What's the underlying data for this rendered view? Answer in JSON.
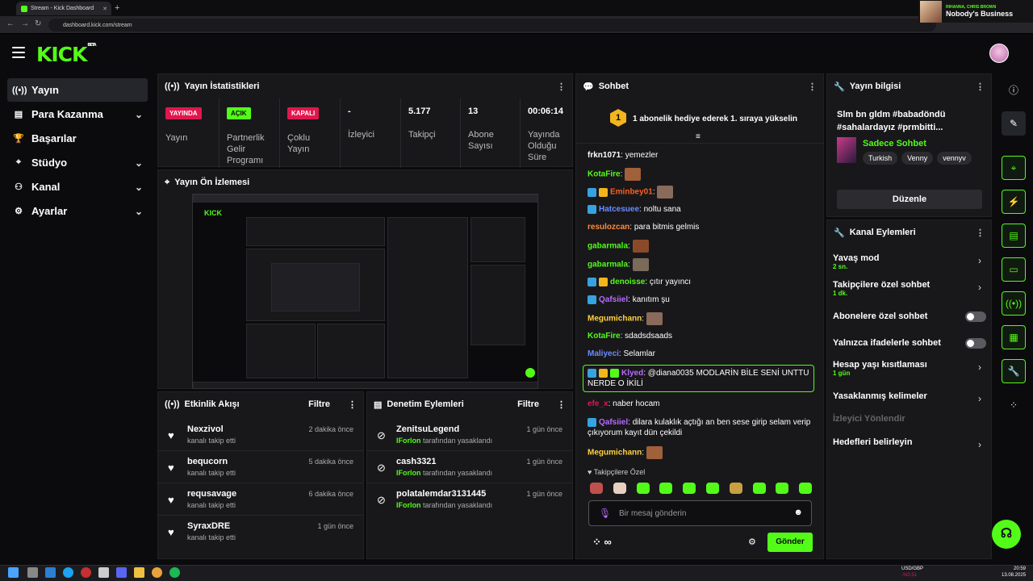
{
  "browser": {
    "tab_title": "Stream - Kick Dashboard",
    "url": "dashboard.kick.com/stream",
    "media_artist": "RIHANNA, CHRIS BROWN",
    "media_song": "Nobody's Business"
  },
  "header": {
    "logo": "KICK",
    "logo_tag": "BETA"
  },
  "sidebar": {
    "items": [
      {
        "label": "Yayın",
        "icon": "broadcast-icon",
        "active": true
      },
      {
        "label": "Para Kazanma",
        "icon": "money-icon",
        "chevron": true
      },
      {
        "label": "Başarılar",
        "icon": "trophy-icon"
      },
      {
        "label": "Stüdyo",
        "icon": "studio-icon",
        "chevron": true
      },
      {
        "label": "Kanal",
        "icon": "channel-icon",
        "chevron": true
      },
      {
        "label": "Ayarlar",
        "icon": "gear-icon",
        "chevron": true
      }
    ]
  },
  "stats": {
    "title": "Yayın İstatistikleri",
    "cols": [
      {
        "badge": "YAYINDA",
        "label": "Yayın",
        "badge_color": "#e0174d"
      },
      {
        "badge": "AÇIK",
        "label": "Partnerlik Gelir Programı",
        "badge_color": "#53fc18"
      },
      {
        "badge": "KAPALI",
        "label": "Çoklu Yayın",
        "badge_color": "#e0174d"
      },
      {
        "value": "-",
        "label": "İzleyici"
      },
      {
        "value": "5.177",
        "label": "Takipçi"
      },
      {
        "value": "13",
        "label": "Abone Sayısı"
      },
      {
        "value": "00:06:14",
        "label": "Yayında Olduğu Süre"
      }
    ]
  },
  "preview": {
    "title": "Yayın Ön İzlemesi"
  },
  "activity": {
    "title": "Etkinlik Akışı",
    "filter": "Filtre",
    "rows": [
      {
        "name": "Nexzivol",
        "sub": "kanalı takip etti",
        "time": "2 dakika önce"
      },
      {
        "name": "bequcorn",
        "sub": "kanalı takip etti",
        "time": "5 dakika önce"
      },
      {
        "name": "requsavage",
        "sub": "kanalı takip etti",
        "time": "6 dakika önce"
      },
      {
        "name": "SyraxDRE",
        "sub": "kanalı takip etti",
        "time": "1 gün önce"
      }
    ]
  },
  "moderation": {
    "title": "Denetim Eylemleri",
    "filter": "Filtre",
    "rows": [
      {
        "name": "ZenitsuLegend",
        "by": "IForlon",
        "sub": "tarafından yasaklandı",
        "time": "1 gün önce"
      },
      {
        "name": "cash3321",
        "by": "IForlon",
        "sub": "tarafından yasaklandı",
        "time": "1 gün önce"
      },
      {
        "name": "polatalemdar3131445",
        "by": "IForlon",
        "sub": "tarafından yasaklandı",
        "time": "1 gün önce"
      }
    ]
  },
  "chat": {
    "title": "Sohbet",
    "pinned": "1 abonelik hediye ederek 1. sıraya yükselin",
    "pinned_rank": "1",
    "messages": [
      {
        "user": "frkn1071",
        "color": "#ffffff",
        "text": "yemezler"
      },
      {
        "user": "KotaFire",
        "color": "#53fc18",
        "text": "",
        "emote": true
      },
      {
        "user": "Eminbey01",
        "color": "#ff5f1f",
        "text": "",
        "emote": true,
        "badges": 2
      },
      {
        "user": "Hatcesuee",
        "color": "#6a8cff",
        "text": "noltu sana",
        "badges": 1
      },
      {
        "user": "resulozcan",
        "color": "#ff8a3d",
        "text": "para bitmis gelmis"
      },
      {
        "user": "gabarmala",
        "color": "#53fc18",
        "text": "",
        "emote": true
      },
      {
        "user": "gabarmala",
        "color": "#53fc18",
        "text": "",
        "emote": true
      },
      {
        "user": "denoisse",
        "color": "#53fc18",
        "text": "çıtır yayıncı",
        "badges": 2
      },
      {
        "user": "Qafsiiel",
        "color": "#b86bff",
        "text": "kanıtım şu",
        "badges": 1
      },
      {
        "user": "Megumichann",
        "color": "#ffd23f",
        "text": "",
        "emote": true
      },
      {
        "user": "KotaFire",
        "color": "#53fc18",
        "text": "sdadsdsaads"
      },
      {
        "user": "Maliyeci",
        "color": "#6a8cff",
        "text": "Selamlar"
      },
      {
        "user": "Klyed",
        "color": "#b86bff",
        "text": "@diana0035 MODLARİN BİLE SENİ UNTTU NERDE O İKİLİ",
        "badges": 3
      },
      {
        "user": "efe_x",
        "color": "#e0174d",
        "text": "naber hocam"
      },
      {
        "user": "Qafsiiel",
        "color": "#b86bff",
        "text": "dilara kulaklık açtığı an ben sese girip selam verip çıkıyorum kayıt dün çekildi",
        "badges": 1
      },
      {
        "user": "Megumichann",
        "color": "#ffd23f",
        "text": "",
        "emote": true
      }
    ],
    "emote_section": "Takipçilere Özel",
    "input_placeholder": "Bir mesaj gönderin",
    "send": "Gönder",
    "infinity": "∞"
  },
  "stream_info": {
    "title": "Yayın bilgisi",
    "text": "Slm bn gldm #babadöndü #sahalardayız #prmbitti...",
    "category": "Sadece Sohbet",
    "tags": [
      "Turkish",
      "Venny",
      "vennyv"
    ],
    "edit": "Düzenle"
  },
  "channel_actions": {
    "title": "Kanal Eylemleri",
    "items": [
      {
        "label": "Yavaş mod",
        "sub": "2 sn.",
        "type": "arrow"
      },
      {
        "label": "Takipçilere özel sohbet",
        "sub": "1 dk.",
        "type": "arrow"
      },
      {
        "label": "Abonelere özel sohbet",
        "type": "toggle"
      },
      {
        "label": "Yalnızca ifadelerle sohbet",
        "type": "toggle"
      },
      {
        "label": "Hesap yaşı kısıtlaması",
        "sub": "1 gün",
        "type": "arrow"
      },
      {
        "label": "Yasaklanmış kelimeler",
        "type": "arrow"
      },
      {
        "label": "İzleyici Yönlendir",
        "type": "disabled"
      },
      {
        "label": "Hedefleri belirleyin",
        "type": "arrow"
      }
    ]
  },
  "taskbar": {
    "ticker": "USD/GBP",
    "ticker_change": "-%0,51",
    "time": "20:59",
    "date": "13.08.2025"
  },
  "colors": {
    "accent": "#53fc18",
    "live": "#e0174d",
    "panel": "#18181b",
    "bg": "#0b0b0d"
  }
}
